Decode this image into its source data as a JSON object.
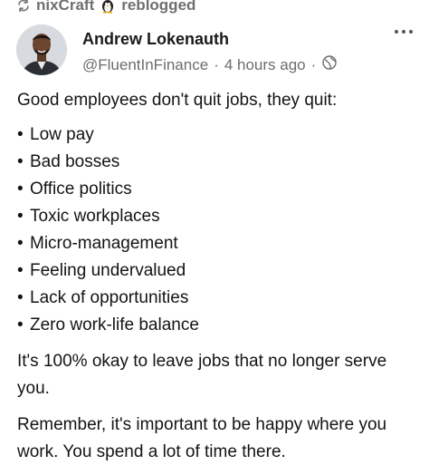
{
  "reblog": {
    "user": "nixCraft",
    "action": "reblogged",
    "icon": "reblog-icon",
    "mascot_icon": "penguin-icon"
  },
  "author": {
    "name": "Andrew Lokenauth",
    "handle": "@FluentInFinance",
    "sep1": "·",
    "time": "4 hours ago",
    "sep2": "·",
    "visibility_icon": "globe-icon"
  },
  "menu_icon": "more-options-icon",
  "post": {
    "intro": "Good employees don't quit jobs, they quit:",
    "bullet_char": "•",
    "points": [
      "Low pay",
      "Bad bosses",
      "Office politics",
      "Toxic workplaces",
      "Micro-management",
      "Feeling undervalued",
      "Lack of opportunities",
      "Zero work-life balance"
    ],
    "paragraph1": "It's 100% okay to leave jobs that no longer serve you.",
    "paragraph2": "Remember, it's important to be happy where you work. You spend a lot of time there."
  }
}
